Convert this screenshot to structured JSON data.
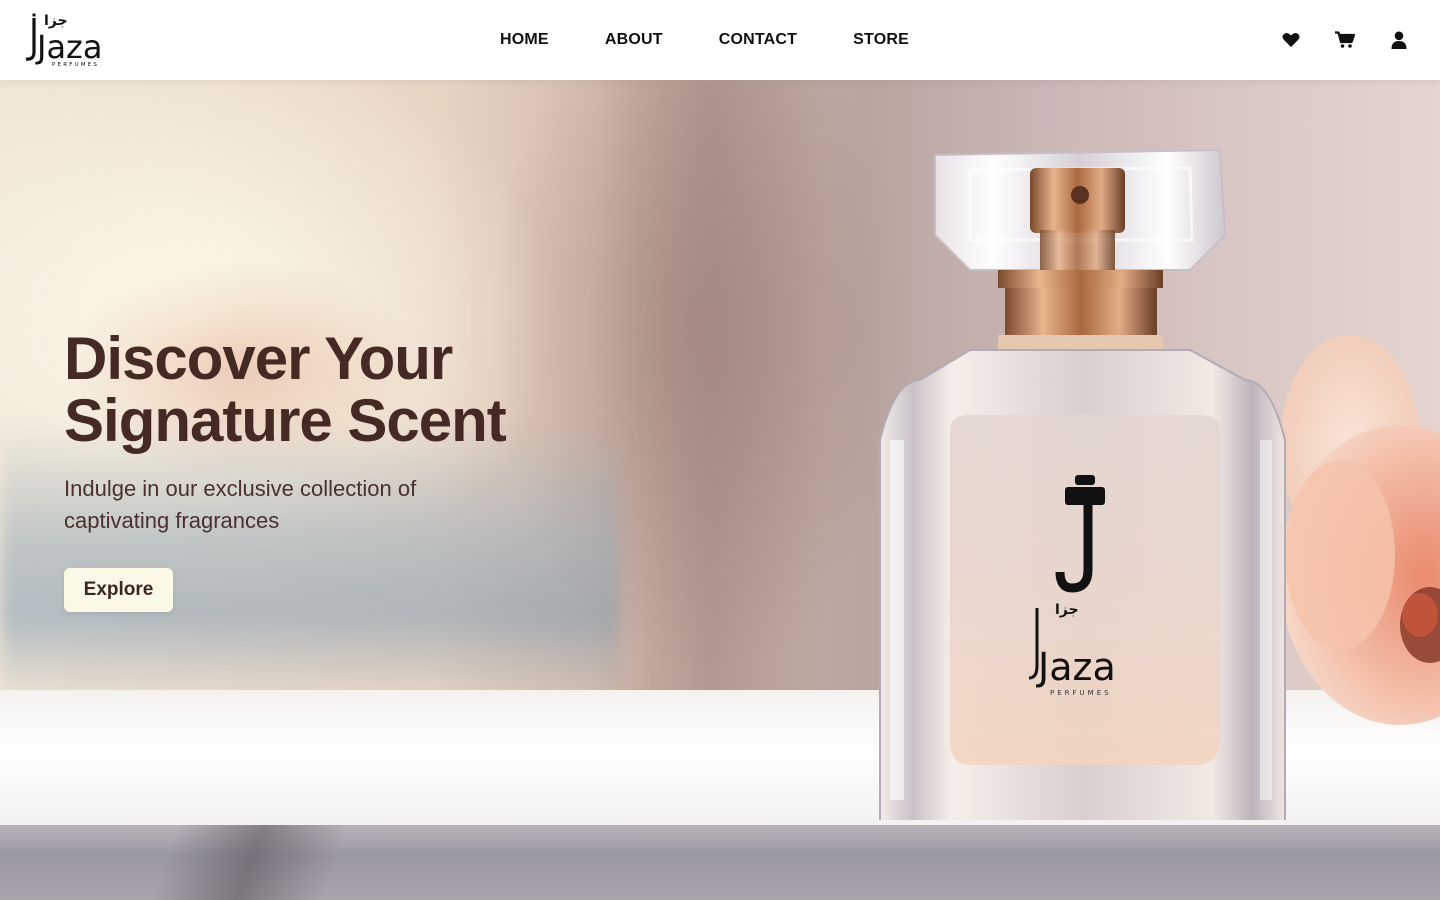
{
  "brand": {
    "logo_text": "Jaza",
    "logo_subtext": "PERFUMES",
    "logo_arabic": "جزا"
  },
  "nav": {
    "items": [
      {
        "label": "HOME"
      },
      {
        "label": "ABOUT"
      },
      {
        "label": "CONTACT"
      },
      {
        "label": "STORE"
      }
    ]
  },
  "header_icons": [
    "heart-icon",
    "cart-icon",
    "user-icon"
  ],
  "hero": {
    "title_line1": "Discover Your",
    "title_line2": "Signature Scent",
    "subtitle_line1": "Indulge in our exclusive collection of",
    "subtitle_line2": "captivating fragrances",
    "cta_label": "Explore",
    "bottle_logo_text": "Jaza",
    "bottle_logo_subtext": "PERFUMES",
    "bottle_logo_arabic": "جزا"
  },
  "colors": {
    "title": "#452a24",
    "cta_bg": "#fbf8e6",
    "nav_text": "#111111"
  }
}
